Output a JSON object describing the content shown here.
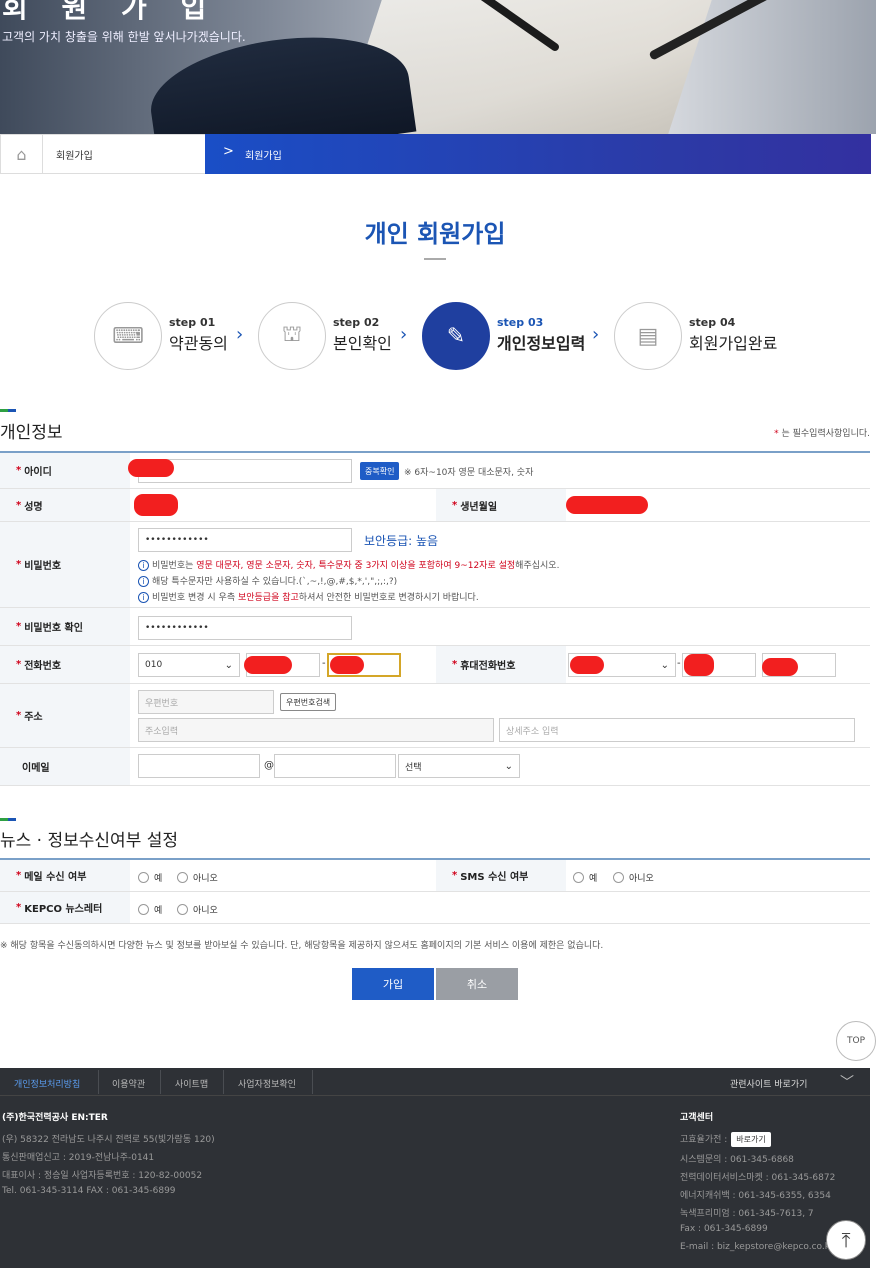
{
  "hero": {
    "title": "회 원 가 입",
    "subtitle": "고객의 가치 창출을 위해 한발 앞서나가겠습니다."
  },
  "breadcrumb": {
    "home_icon": "home-icon",
    "item1": "회원가입",
    "chevron": ">",
    "item2": "회원가입"
  },
  "page": {
    "title": "개인 회원가입"
  },
  "steps": [
    {
      "num": "step 01",
      "name": "약관동의",
      "icon": "keyboard-icon"
    },
    {
      "num": "step 02",
      "name": "본인확인",
      "icon": "org-chart-icon"
    },
    {
      "num": "step 03",
      "name": "개인정보입력",
      "icon": "document-pen-icon"
    },
    {
      "num": "step 04",
      "name": "회원가입완료",
      "icon": "id-card-icon"
    }
  ],
  "personal": {
    "section_title": "개인정보",
    "required_note_star": "*",
    "required_note": " 는 필수입력사항입니다.",
    "id": {
      "label": "아이디",
      "check_button": "중복확인",
      "hint": "※ 6자~10자 영문 대소문자, 숫자"
    },
    "name": {
      "label": "성명"
    },
    "birth": {
      "label": "생년월일"
    },
    "password": {
      "label": "비밀번호",
      "value": "••••••••••••",
      "level": "보안등급: 높음",
      "hint1_a": "비밀번호는 ",
      "hint1_b": "영문 대문자, 영문 소문자, 숫자, 특수문자 중 3가지 이상을 포함하여 9~12자로 설정",
      "hint1_c": "해주십시오.",
      "hint2": "해당 특수문자만 사용하실 수 있습니다.(`,~,!,@,#,$,*,',\",;,:,?)",
      "hint3_a": "비밀번호 변경 시 우측 ",
      "hint3_b": "보안등급을 참고",
      "hint3_c": "하셔서 안전한 비밀번호로 변경하시기 바랍니다."
    },
    "password_confirm": {
      "label": "비밀번호 확인",
      "value": "••••••••••••"
    },
    "phone": {
      "label": "전화번호",
      "area": "010",
      "dash": "-"
    },
    "mobile": {
      "label": "휴대전화번호",
      "dash": "-"
    },
    "address": {
      "label": "주소",
      "zip_placeholder": "우편번호",
      "zip_button": "우편번호검색",
      "addr_placeholder": "주소입력",
      "detail_placeholder": "상세주소 입력"
    },
    "email": {
      "label": "이메일",
      "at": "@",
      "domain_select": "선택"
    }
  },
  "news": {
    "section_title": "뉴스 · 정보수신여부 설정",
    "mail": {
      "label": "메일 수신 여부",
      "yes": "예",
      "no": "아니오"
    },
    "sms": {
      "label": "SMS 수신 여부",
      "yes": "예",
      "no": "아니오"
    },
    "newsletter": {
      "label": "KEPCO 뉴스레터",
      "yes": "예",
      "no": "아니오"
    },
    "notice": "※ 해당 항목을 수신동의하시면 다양한 뉴스 및 정보를 받아보실 수 있습니다. 단, 해당항목을 제공하지 않으셔도 홈페이지의 기본 서비스 이용에 제한은 없습니다."
  },
  "buttons": {
    "join": "가입",
    "cancel": "취소",
    "top": "TOP"
  },
  "colors": {
    "primary": "#1f5cc6",
    "step_active": "#1f3f9f",
    "required": "#d0021b",
    "cancel": "#9a9ea4",
    "footer_bg": "#2e3136"
  },
  "footer": {
    "nav": [
      "개인정보처리방침",
      "이용약관",
      "사이트맵",
      "사업자정보확인"
    ],
    "related": "관련사이트 바로가기",
    "company": "(주)한국전력공사 EN:TER",
    "address": "(우) 58322 전라남도 나주시 전력로 55(빛가람동 120)",
    "mail_order": "통신판매업신고 : 2019-전남나주-0141",
    "ceo": "대표이사 : 정승일 사업자등록번호 : 120-82-00052",
    "tel_fax": "Tel. 061-345-3114     FAX : 061-345-6899",
    "cs_title": "고객센터",
    "cs_lines": [
      "고효율가전 :",
      "시스템문의 : 061-345-6868",
      "전력데이터서비스마켓 : 061-345-6872",
      "에너지캐쉬백 : 061-345-6355, 6354",
      "녹색프리미엄 : 061-345-7613, 7",
      "Fax : 061-345-6899",
      "E-mail : biz_kepstore@kepco.co.kr"
    ],
    "goto_button": "바로가기"
  }
}
